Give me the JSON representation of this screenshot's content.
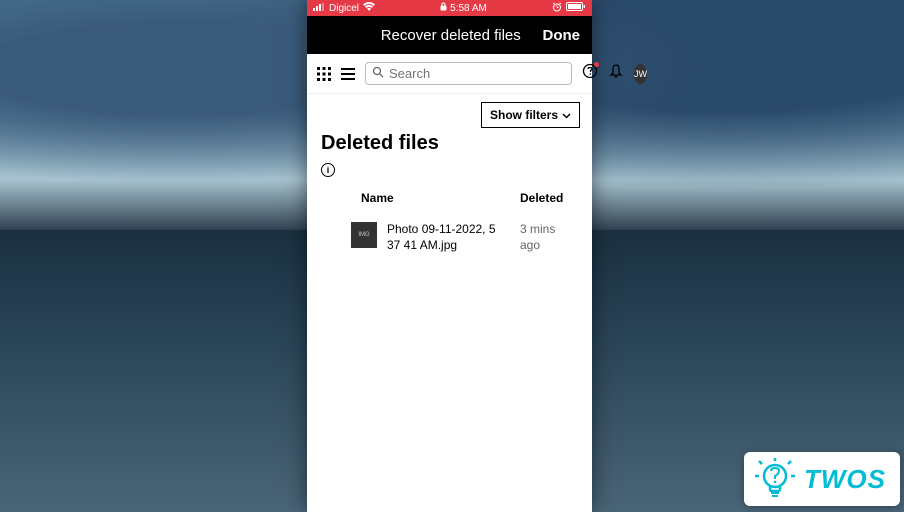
{
  "status_bar": {
    "carrier": "Digicel",
    "time": "5:58 AM"
  },
  "nav": {
    "title": "Recover deleted files",
    "done": "Done"
  },
  "toolbar": {
    "search_placeholder": "Search",
    "avatar_initials": "JW"
  },
  "filters": {
    "show_filters": "Show filters"
  },
  "page": {
    "title": "Deleted files"
  },
  "table": {
    "headers": {
      "name": "Name",
      "deleted": "Deleted"
    },
    "rows": [
      {
        "name": "Photo 09-11-2022, 5 37 41 AM.jpg",
        "deleted": "3 mins ago"
      }
    ]
  },
  "badge": {
    "text": "TWOS"
  }
}
